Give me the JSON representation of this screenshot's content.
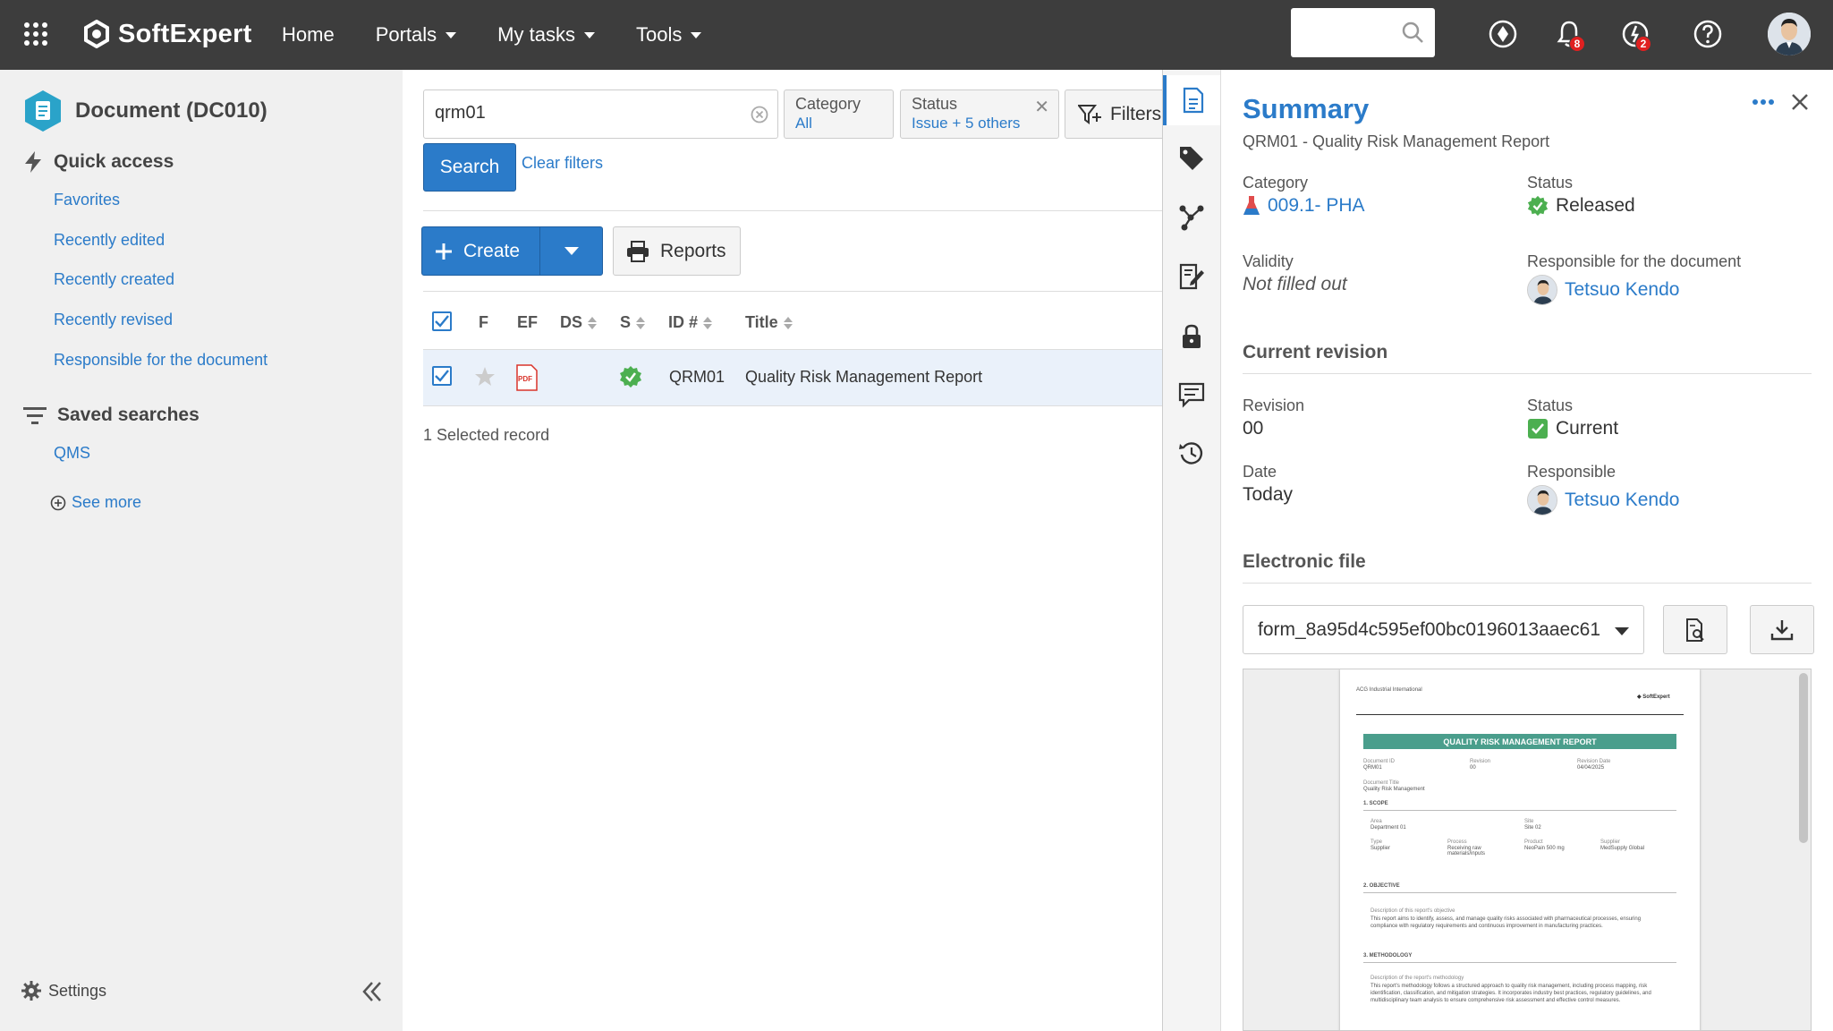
{
  "colors": {
    "accent": "#2b7bc9",
    "topbar": "#3d3d3d",
    "success": "#4caf50",
    "badge": "#e02020",
    "banner": "#4a9e8c"
  },
  "topbar": {
    "logo_text": "SoftExpert",
    "nav": [
      {
        "label": "Home",
        "has_menu": false
      },
      {
        "label": "Portals",
        "has_menu": true
      },
      {
        "label": "My tasks",
        "has_menu": true
      },
      {
        "label": "Tools",
        "has_menu": true
      }
    ],
    "search_value": "",
    "notifications_badge": "8",
    "activity_badge": "2"
  },
  "sidebar": {
    "title": "Document (DC010)",
    "quick_access_label": "Quick access",
    "quick_links": [
      "Favorites",
      "Recently edited",
      "Recently created",
      "Recently revised",
      "Responsible for the document"
    ],
    "saved_searches_label": "Saved searches",
    "saved_links": [
      "QMS"
    ],
    "see_more": "See more",
    "settings": "Settings"
  },
  "main": {
    "query": "qrm01",
    "filters": {
      "category_label": "Category",
      "category_value": "All",
      "status_label": "Status",
      "status_value": "Issue + 5 others",
      "filters_button": "Filters"
    },
    "search_button": "Search",
    "clear_filters": "Clear filters",
    "create_button": "Create",
    "reports_button": "Reports",
    "columns": {
      "f": "F",
      "ef": "EF",
      "ds": "DS",
      "s": "S",
      "id": "ID #",
      "title": "Title"
    },
    "rows": [
      {
        "ef": "PDF",
        "id": "QRM01",
        "title": "Quality Risk Management Report"
      }
    ],
    "selected_text": "1 Selected record"
  },
  "panel": {
    "title": "Summary",
    "subtitle": "QRM01 - Quality Risk Management Report",
    "category_label": "Category",
    "category_value": "009.1- PHA",
    "status_label": "Status",
    "status_value": "Released",
    "validity_label": "Validity",
    "validity_value": "Not filled out",
    "responsible_doc_label": "Responsible for the document",
    "responsible_doc_value": "Tetsuo Kendo",
    "current_revision_head": "Current revision",
    "revision_label": "Revision",
    "revision_value": "00",
    "rev_status_label": "Status",
    "rev_status_value": "Current",
    "date_label": "Date",
    "date_value": "Today",
    "responsible_label": "Responsible",
    "responsible_value": "Tetsuo Kendo",
    "electronic_file_head": "Electronic file",
    "file_name": "form_8a95d4c595ef00bc0196013aaec61"
  },
  "preview": {
    "company": "ACG Industrial International",
    "logo": "SoftExpert",
    "banner": "QUALITY RISK MANAGEMENT REPORT",
    "doc_id_label": "Document ID",
    "doc_id": "QRM01",
    "revision_label": "Revision",
    "revision": "00",
    "rev_date_label": "Revision Date",
    "rev_date": "04/04/2025",
    "doc_title_label": "Document Title",
    "doc_title": "Quality Risk Management",
    "scope_head": "1. SCOPE",
    "area_label": "Area",
    "area": "Department 01",
    "site_label": "Site",
    "site": "Site 02",
    "type_label": "Type",
    "type": "Supplier",
    "process_label": "Process",
    "process": "Receiving raw materials/inputs",
    "product_label": "Product",
    "product": "NeoPain 500 mg",
    "supplier_label": "Supplier",
    "supplier": "MedSupply Global",
    "objective_head": "2. OBJECTIVE",
    "objective_desc_label": "Description of this report's objective",
    "objective_text": "This report aims to identify, assess, and manage quality risks associated with pharmaceutical processes, ensuring compliance with regulatory requirements and continuous improvement in manufacturing practices.",
    "methodology_head": "3. METHODOLOGY",
    "methodology_desc_label": "Description of the report's methodology",
    "methodology_text": "This report's methodology follows a structured approach to quality risk management, including process mapping, risk identification, classification, and mitigation strategies. It incorporates industry best practices, regulatory guidelines, and multidisciplinary team analysis to ensure comprehensive risk assessment and effective control measures."
  }
}
